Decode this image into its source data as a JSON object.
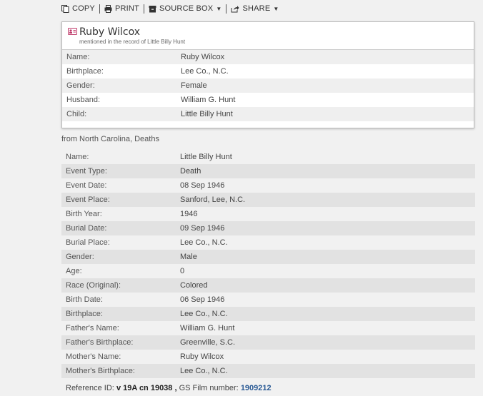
{
  "toolbar": {
    "copy": "COPY",
    "print": "PRINT",
    "source_box": "SOURCE BOX",
    "share": "SHARE"
  },
  "card": {
    "title": "Ruby Wilcox",
    "subtitle": "mentioned in the record of Little Billy Hunt",
    "rows": [
      {
        "label": "Name:",
        "value": "Ruby Wilcox",
        "style": "maroon"
      },
      {
        "label": "Birthplace:",
        "value": "Lee Co., N.C.",
        "style": "plain"
      },
      {
        "label": "Gender:",
        "value": "Female",
        "style": "plain"
      },
      {
        "label": "Husband:",
        "value": "William G. Hunt",
        "style": "maroon"
      },
      {
        "label": "Child:",
        "value": "Little Billy Hunt",
        "style": "blue"
      }
    ]
  },
  "source_note": "from North Carolina, Deaths",
  "record": {
    "rows": [
      {
        "label": "Name:",
        "value": "Little Billy Hunt",
        "style": "blue"
      },
      {
        "label": "Event Type:",
        "value": "Death",
        "style": "plain"
      },
      {
        "label": "Event Date:",
        "value": "08 Sep 1946",
        "style": "plain"
      },
      {
        "label": "Event Place:",
        "value": "Sanford, Lee, N.C.",
        "style": "plain"
      },
      {
        "label": "Birth Year:",
        "value": "1946",
        "style": "plain"
      },
      {
        "label": "Burial Date:",
        "value": "09 Sep 1946",
        "style": "plain"
      },
      {
        "label": "Burial Place:",
        "value": "Lee Co., N.C.",
        "style": "plain"
      },
      {
        "label": "Gender:",
        "value": "Male",
        "style": "plain"
      },
      {
        "label": "Age:",
        "value": "0",
        "style": "plain"
      },
      {
        "label": "Race (Original):",
        "value": "Colored",
        "style": "plain"
      },
      {
        "label": "Birth Date:",
        "value": "06 Sep 1946",
        "style": "plain"
      },
      {
        "label": "Birthplace:",
        "value": "Lee Co., N.C.",
        "style": "plain"
      },
      {
        "label": "Father's Name:",
        "value": "William G. Hunt",
        "style": "maroon"
      },
      {
        "label": "Father's Birthplace:",
        "value": "Greenville, S.C.",
        "style": "plain"
      },
      {
        "label": "Mother's Name:",
        "value": "Ruby Wilcox",
        "style": "maroon"
      },
      {
        "label": "Mother's Birthplace:",
        "value": "Lee Co., N.C.",
        "style": "plain"
      }
    ]
  },
  "reference": {
    "ref_label": "Reference ID:",
    "ref_value": "v 19A cn 19038",
    "sep": ",",
    "film_label": "GS Film number:",
    "film_value": "1909212"
  }
}
